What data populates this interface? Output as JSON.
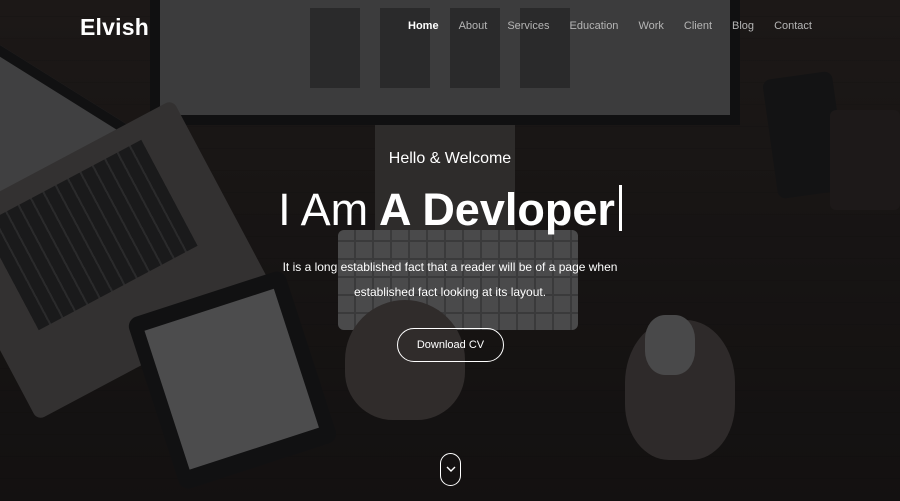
{
  "brand": {
    "logo": "Elvish"
  },
  "nav": {
    "items": [
      {
        "label": "Home",
        "active": true
      },
      {
        "label": "About"
      },
      {
        "label": "Services"
      },
      {
        "label": "Education"
      },
      {
        "label": "Work"
      },
      {
        "label": "Client"
      },
      {
        "label": "Blog"
      },
      {
        "label": "Contact"
      }
    ]
  },
  "hero": {
    "greeting": "Hello & Welcome",
    "headline_light": "I Am",
    "headline_bold": "A Devloper",
    "description_line1": "It is a long established fact that a reader will be of a page when",
    "description_line2": "established fact looking at its layout.",
    "cta_label": "Download CV",
    "scroll_icon": "chevron-down-icon"
  },
  "colors": {
    "text": "#ffffff",
    "nav_inactive": "#b5b5b5",
    "overlay": "#0a0a0c"
  }
}
